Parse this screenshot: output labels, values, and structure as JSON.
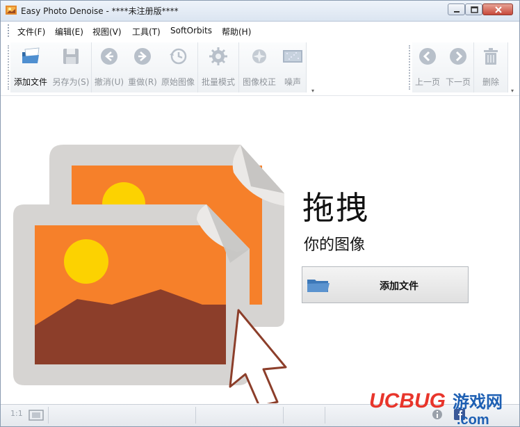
{
  "window": {
    "title": "Easy Photo Denoise - ****未注册版****"
  },
  "menu": {
    "items": [
      {
        "label": "文件(F)"
      },
      {
        "label": "编辑(E)"
      },
      {
        "label": "视图(V)"
      },
      {
        "label": "工具(T)"
      },
      {
        "label": "SoftOrbits"
      },
      {
        "label": "帮助(H)"
      }
    ]
  },
  "toolbar": {
    "add_file": "添加文件",
    "save_as": "另存为(S)",
    "undo": "撤消(U)",
    "redo": "重做(R)",
    "original": "原始图像",
    "batch": "批量模式",
    "correction": "图像校正",
    "noise": "噪声",
    "prev_page": "上一页",
    "next_page": "下一页",
    "delete": "删除"
  },
  "drop_zone": {
    "title": "拖拽",
    "subtitle": "你的图像",
    "add_button": "添加文件"
  },
  "status": {
    "zoom_label": "1:1"
  },
  "watermark": {
    "brand": "UCBUG",
    "site_cn": "游戏网",
    "domain": ".com"
  },
  "colors": {
    "orange": "#f6802a",
    "sun": "#fcd201",
    "mountain": "#8c3e2a",
    "frame": "#d6d4d2",
    "folder_blue": "#3d78b8"
  }
}
